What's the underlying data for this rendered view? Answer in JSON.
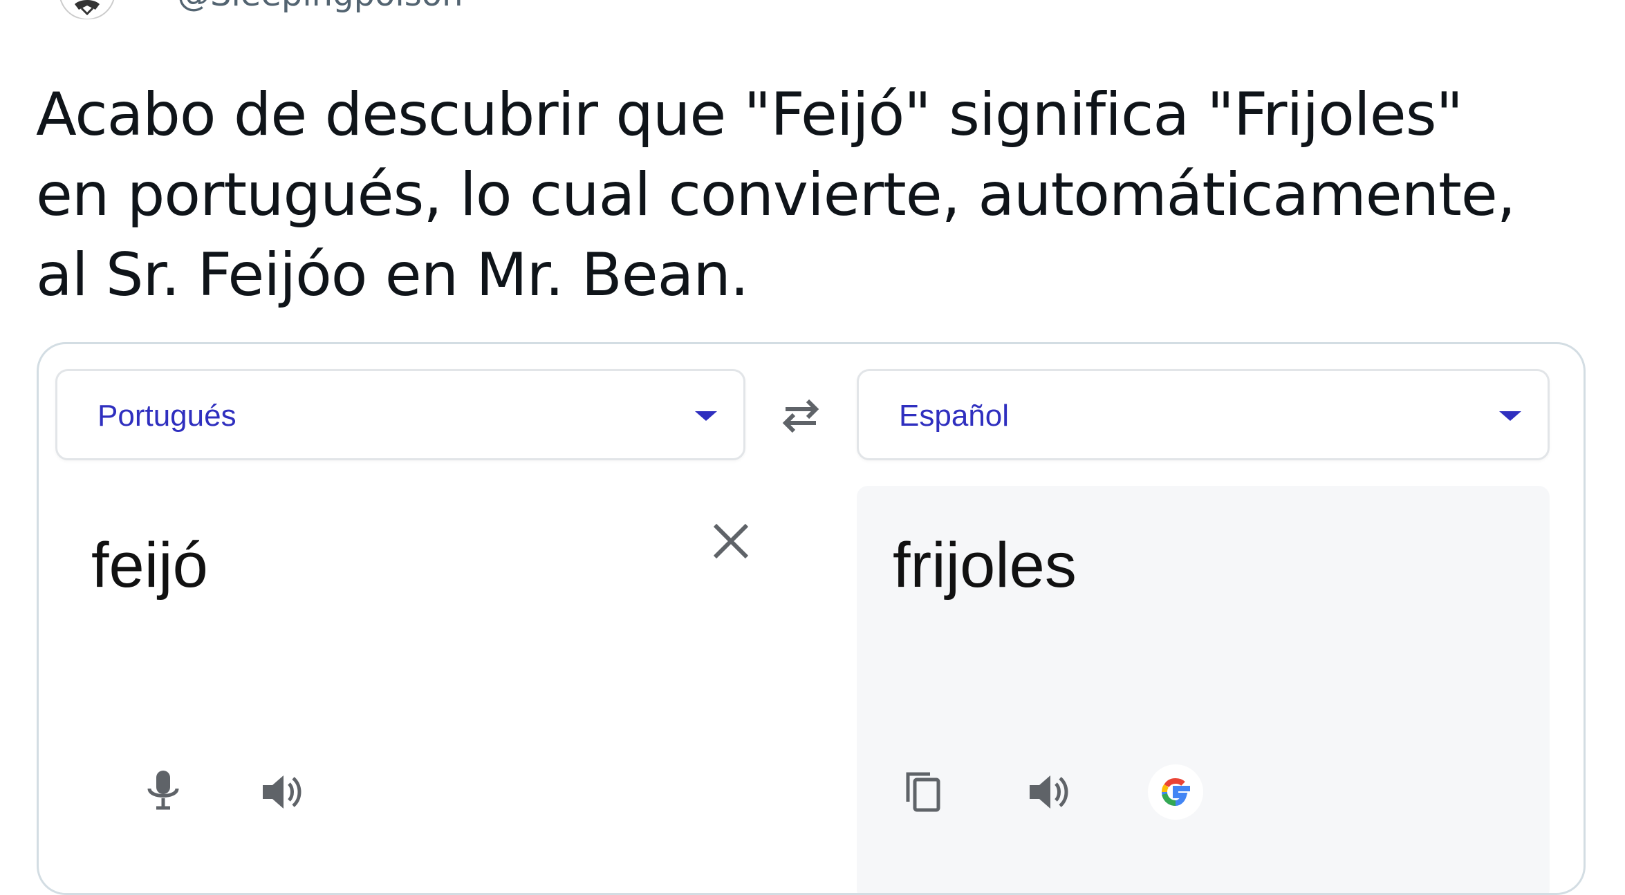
{
  "author": {
    "handle": "@Sleepingpoison"
  },
  "tweet": {
    "text": "Acabo de descubrir que \"Feijó\" significa \"Frijoles\"\nen portugués, lo cual convierte, automáticamente,\nal Sr. Feijóo en Mr. Bean."
  },
  "translator": {
    "source_language": "Portugués",
    "target_language": "Español",
    "source_text": "feijó",
    "translated_text": "frijoles",
    "accent_color": "#2f2fbf"
  },
  "icons": {
    "swap": "swap-languages-icon",
    "clear": "close-icon",
    "mic": "microphone-icon",
    "speaker": "speaker-icon",
    "copy": "copy-icon",
    "google": "google-logo-icon"
  }
}
